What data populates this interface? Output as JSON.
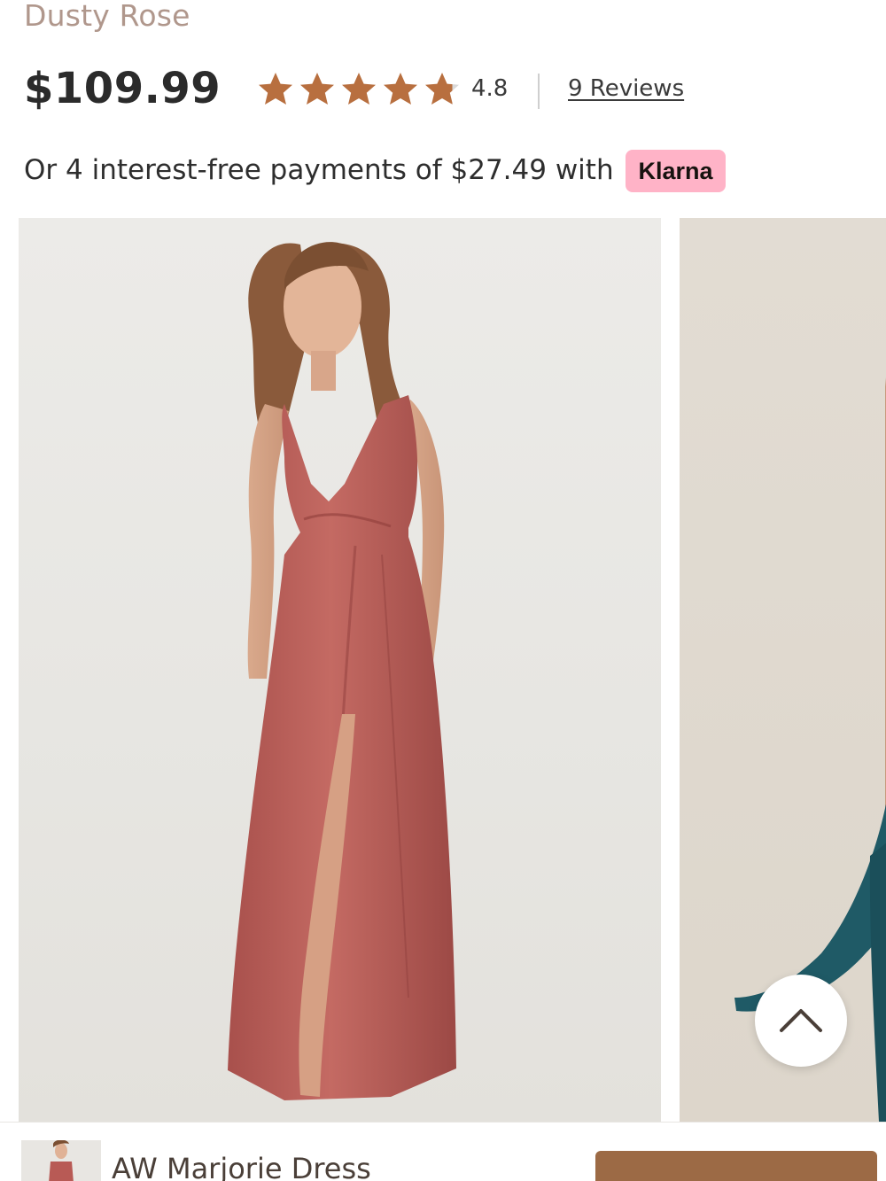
{
  "product": {
    "color_name": "Dusty Rose",
    "price": "$109.99",
    "rating": {
      "value": "4.8",
      "stars_total": 5,
      "stars_filled": 4.8,
      "star_color": "#b86f3f",
      "star_empty_color": "#d9d9d9"
    },
    "reviews_link": "9 Reviews",
    "installment_text": "Or 4 interest-free payments of $27.49 with",
    "klarna_label": "Klarna",
    "name": "AW Marjorie Dress"
  },
  "gallery": {
    "slides": [
      {
        "dress_color": "#b85a55",
        "subject": "model in dusty rose velvet dress"
      },
      {
        "dress_color": "#1f5a66",
        "subject": "teal dress"
      }
    ]
  },
  "icons": {
    "scroll_top": "chevron-up-icon",
    "star": "star-icon"
  },
  "colors": {
    "accent_button": "#9c6a45",
    "klarna_pink": "#ffb3c7",
    "muted_text": "#b0978c"
  }
}
